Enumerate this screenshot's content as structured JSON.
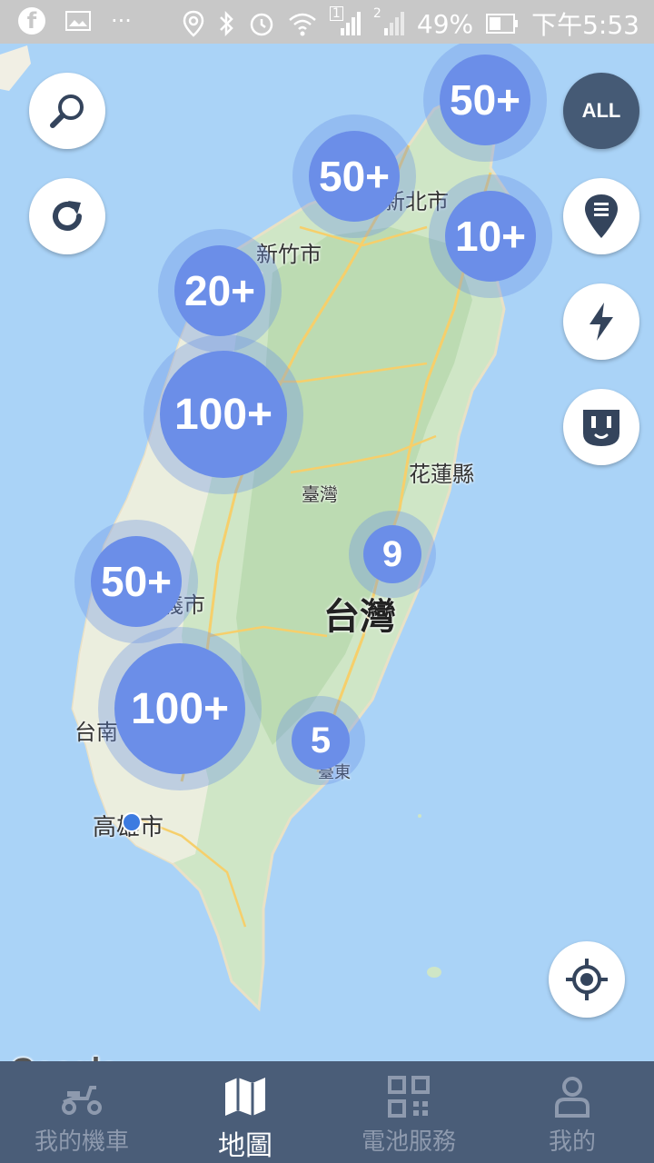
{
  "status_bar": {
    "battery": "49%",
    "time": "下午5:53",
    "sim1": "1",
    "sim2": "2"
  },
  "map": {
    "labels": {
      "new_taipei": "新北市",
      "hsinchu": "新竹市",
      "hualien": "花蓮縣",
      "taiwan_small": "臺灣",
      "taiwan_big": "台灣",
      "chiayi_partial": "義市",
      "tainan_partial": "台南",
      "taitung": "臺東",
      "kaohsiung": "高雄市"
    },
    "clusters": [
      {
        "label": "50+"
      },
      {
        "label": "50+"
      },
      {
        "label": "10+"
      },
      {
        "label": "20+"
      },
      {
        "label": "100+"
      },
      {
        "label": "9"
      },
      {
        "label": "50+"
      },
      {
        "label": "100+"
      },
      {
        "label": "5"
      }
    ],
    "attribution": "Google"
  },
  "controls": {
    "filter_all": "ALL",
    "icons": [
      "search-icon",
      "refresh-icon",
      "list-pin-icon",
      "lightning-icon",
      "outlet-icon",
      "locate-icon"
    ]
  },
  "colors": {
    "cluster": "#6b8ee8",
    "tabbar": "#4a5d78",
    "water": "#aad3f7",
    "land": "#cde6c3"
  },
  "tabs": [
    {
      "label": "我的機車",
      "icon": "scooter-icon",
      "active": false
    },
    {
      "label": "地圖",
      "icon": "map-icon",
      "active": true
    },
    {
      "label": "電池服務",
      "icon": "qr-code-icon",
      "active": false
    },
    {
      "label": "我的",
      "icon": "profile-icon",
      "active": false
    }
  ]
}
